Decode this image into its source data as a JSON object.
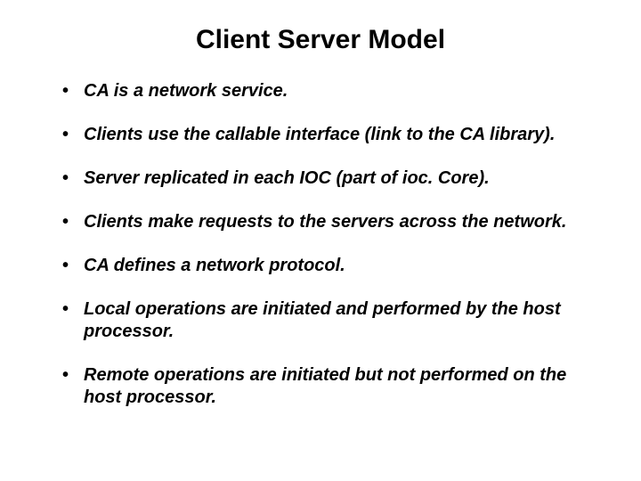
{
  "title": "Client Server Model",
  "bullets": [
    "CA is a network service.",
    "Clients use the callable interface (link to the CA library).",
    "Server replicated in each IOC (part of ioc. Core).",
    "Clients make requests to the servers across the network.",
    "CA defines a network protocol.",
    "Local operations are initiated and performed by the host processor.",
    "Remote operations are initiated but not performed on the host processor."
  ]
}
